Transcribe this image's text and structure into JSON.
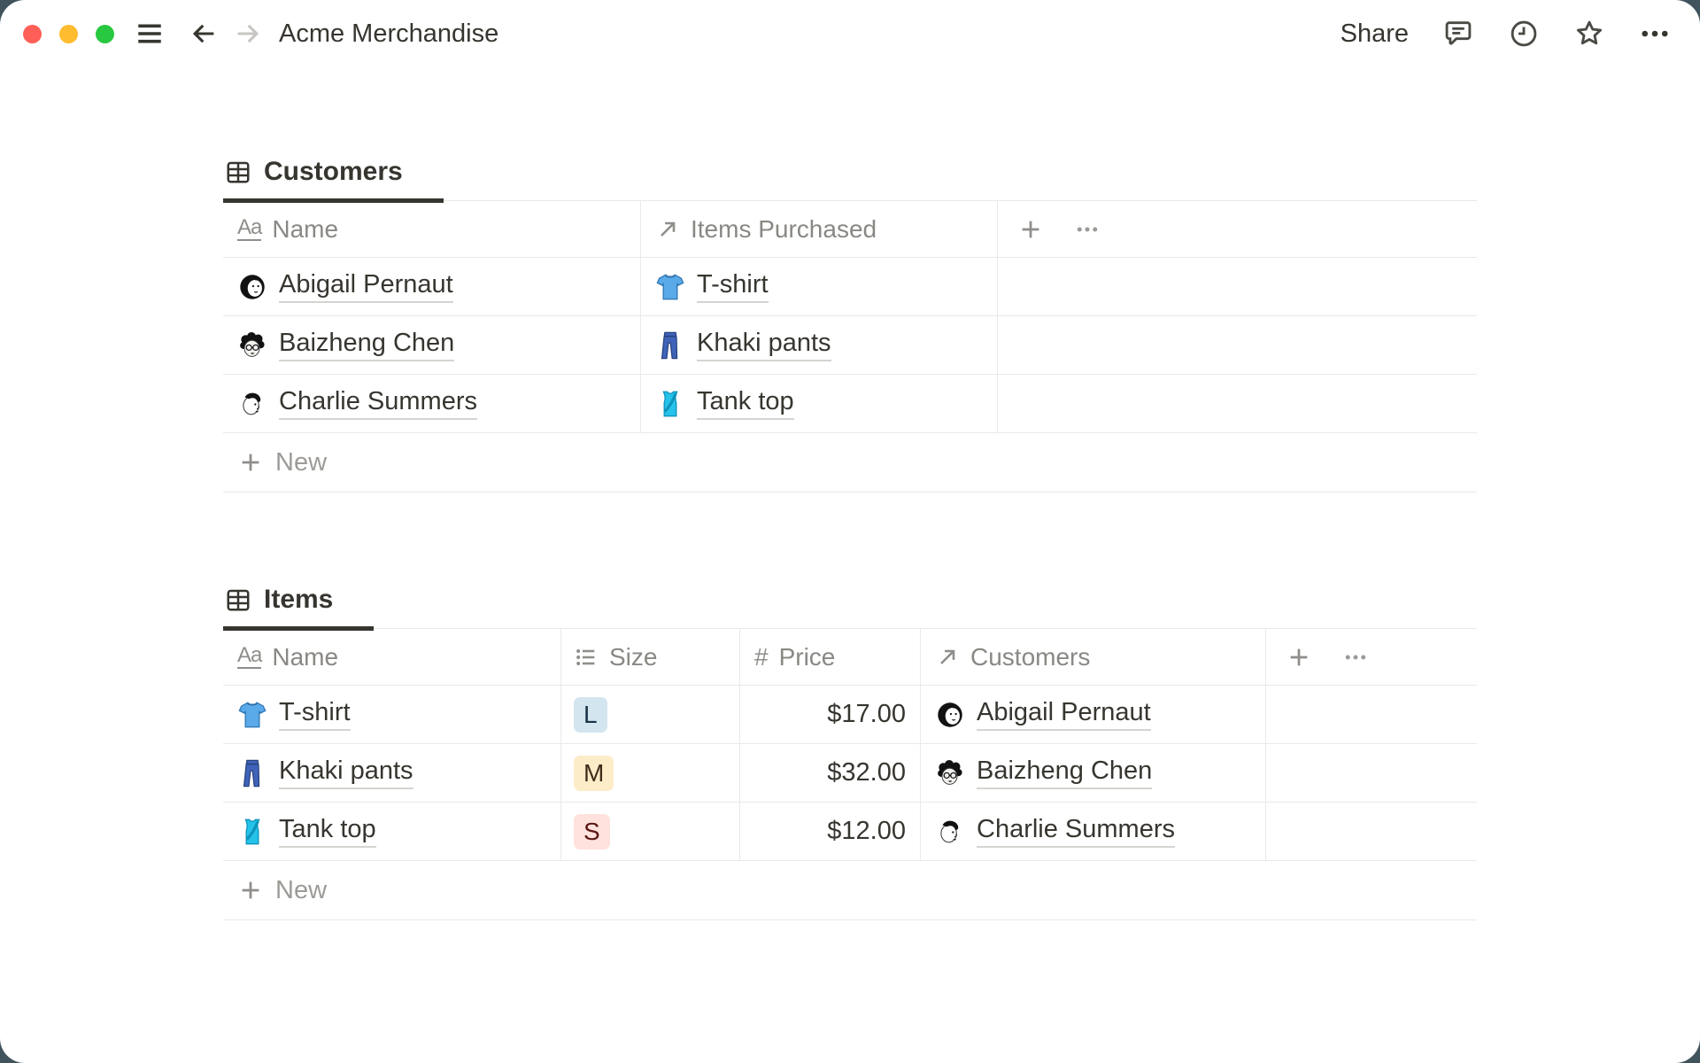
{
  "window": {
    "title": "Acme Merchandise",
    "share_label": "Share"
  },
  "icons": {
    "text_property_glyph": "Aa",
    "number_property_glyph": "#"
  },
  "colors": {
    "backdrop": "#41535d",
    "text_primary": "#37352f",
    "text_secondary": "#8a8884",
    "divider": "#e9e9e7",
    "traffic_red": "#ff5f57",
    "traffic_yellow": "#febc2e",
    "traffic_green": "#28c840",
    "badge_blue_bg": "#d3e5ef",
    "badge_amber_bg": "#fdecc8",
    "badge_red_bg": "#ffe2dd"
  },
  "customers_table": {
    "tab_label": "Customers",
    "columns": [
      {
        "label": "Name",
        "type": "text"
      },
      {
        "label": "Items Purchased",
        "type": "relation"
      }
    ],
    "rows": [
      {
        "name": "Abigail Pernaut",
        "item": "T-shirt"
      },
      {
        "name": "Baizheng Chen",
        "item": "Khaki pants"
      },
      {
        "name": "Charlie Summers",
        "item": "Tank top"
      }
    ],
    "new_label": "New"
  },
  "items_table": {
    "tab_label": "Items",
    "columns": [
      {
        "label": "Name",
        "type": "text"
      },
      {
        "label": "Size",
        "type": "select"
      },
      {
        "label": "Price",
        "type": "number"
      },
      {
        "label": "Customers",
        "type": "relation"
      }
    ],
    "rows": [
      {
        "name": "T-shirt",
        "size": "L",
        "price": "$17.00",
        "customer": "Abigail Pernaut"
      },
      {
        "name": "Khaki pants",
        "size": "M",
        "price": "$32.00",
        "customer": "Baizheng Chen"
      },
      {
        "name": "Tank top",
        "size": "S",
        "price": "$12.00",
        "customer": "Charlie Summers"
      }
    ],
    "new_label": "New"
  }
}
